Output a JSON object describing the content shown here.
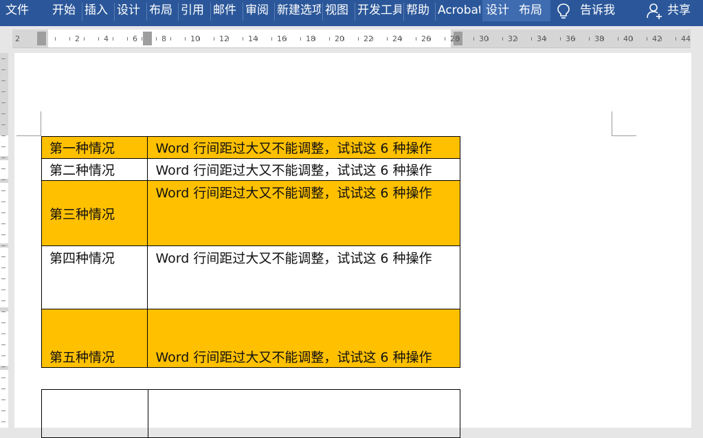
{
  "ribbon": {
    "tabs": [
      {
        "label": "文件"
      },
      {
        "label": "开始"
      },
      {
        "label": "插入"
      },
      {
        "label": "设计"
      },
      {
        "label": "布局"
      },
      {
        "label": "引用"
      },
      {
        "label": "邮件"
      },
      {
        "label": "审阅"
      },
      {
        "label": "新建选项卡"
      },
      {
        "label": "视图"
      },
      {
        "label": "开发工具"
      },
      {
        "label": "帮助"
      },
      {
        "label": "Acrobat"
      },
      {
        "label": "设计"
      },
      {
        "label": "布局"
      }
    ],
    "tell_me": "告诉我",
    "share": "共享",
    "icons": {
      "tell_me": "lightbulb-icon",
      "share": "user-plus-icon"
    }
  },
  "ruler": {
    "labels": [
      "2",
      "2",
      "4",
      "6",
      "8",
      "10",
      "12",
      "14",
      "16",
      "18",
      "20",
      "22",
      "24",
      "26",
      "28",
      "30",
      "32",
      "34",
      "36",
      "38",
      "40",
      "42",
      "44"
    ]
  },
  "document": {
    "table": {
      "rows": [
        {
          "label": "第一种情况",
          "content": "Word 行间距过大又不能调整，试试这 6 种操作",
          "highlight": true
        },
        {
          "label": "第二种情况",
          "content": "Word 行间距过大又不能调整，试试这 6 种操作",
          "highlight": false
        },
        {
          "label": "第三种情况",
          "content": "Word 行间距过大又不能调整，试试这 6 种操作",
          "highlight": true
        },
        {
          "label": "第四种情况",
          "content": "Word 行间距过大又不能调整，试试这 6 种操作",
          "highlight": false
        },
        {
          "label": "第五种情况",
          "content": "Word 行间距过大又不能调整，试试这 6 种操作",
          "highlight": true
        }
      ]
    }
  },
  "colors": {
    "ribbon": "#2b579a",
    "highlight": "#ffc000",
    "contextual_tab": "#3f6cb0"
  }
}
